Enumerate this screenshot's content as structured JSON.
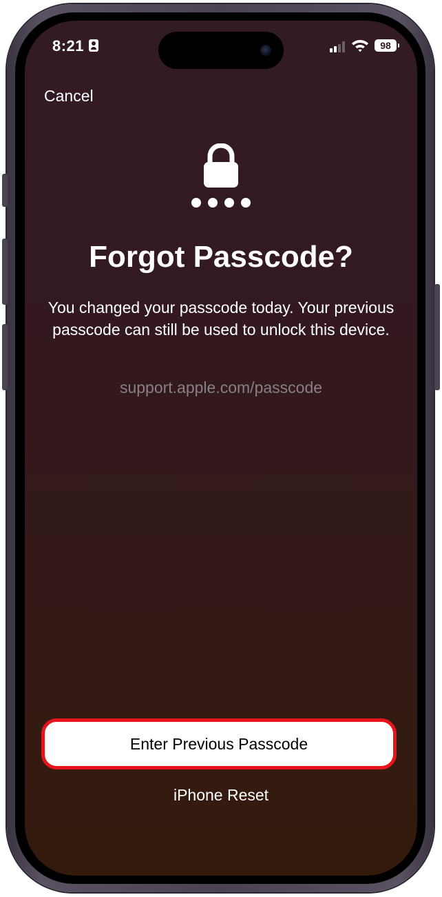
{
  "status_bar": {
    "time": "8:21",
    "battery_level": "98",
    "signal_bars_active": 2,
    "signal_bars_total": 4
  },
  "nav": {
    "cancel_label": "Cancel"
  },
  "icons": {
    "lock": "lock-icon",
    "passcode_dots": "passcode-dots-icon",
    "contact_card": "contact-card-icon",
    "signal": "cellular-signal-icon",
    "wifi": "wifi-icon",
    "battery": "battery-icon"
  },
  "passcode_dot_count": 4,
  "content": {
    "title": "Forgot Passcode?",
    "message": "You changed your passcode today. Your previous passcode can still be used to unlock this device.",
    "support_link": "support.apple.com/passcode"
  },
  "actions": {
    "primary_label": "Enter Previous Passcode",
    "secondary_label": "iPhone Reset"
  },
  "colors": {
    "highlight_border": "#e8141c",
    "background_top": "#331b26",
    "background_bottom": "#341a0b",
    "link_gray": "#8a7f82",
    "text": "#ffffff"
  }
}
